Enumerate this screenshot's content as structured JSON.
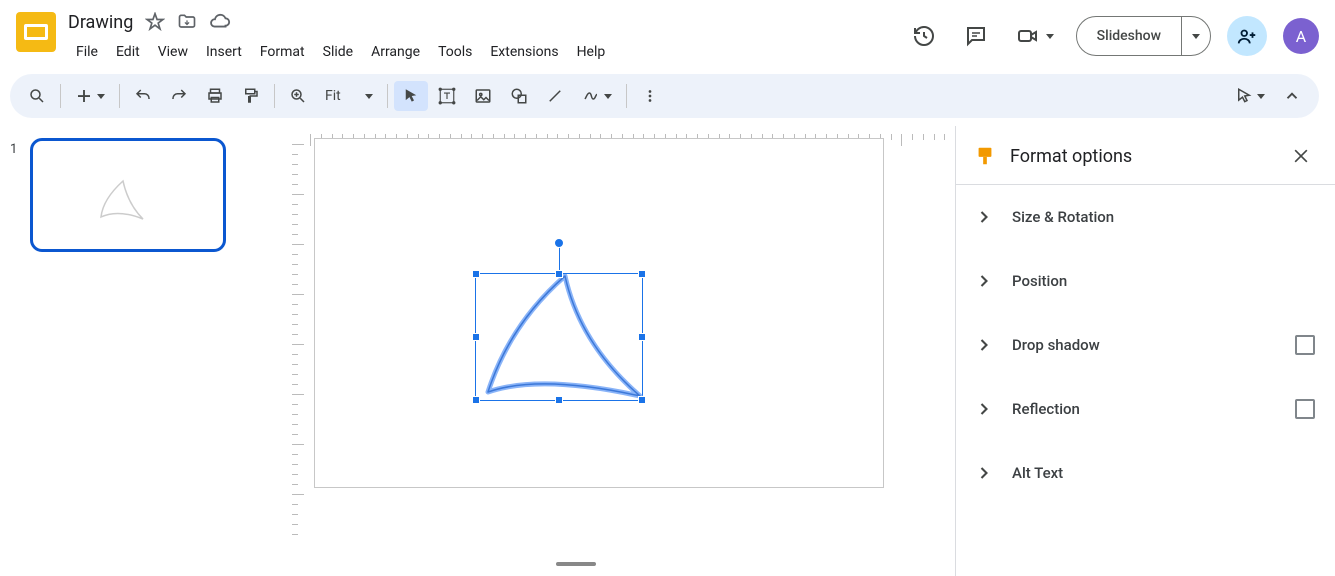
{
  "doc": {
    "title": "Drawing"
  },
  "menus": [
    "File",
    "Edit",
    "View",
    "Insert",
    "Format",
    "Slide",
    "Arrange",
    "Tools",
    "Extensions",
    "Help"
  ],
  "header": {
    "slideshow": "Slideshow",
    "avatar_initial": "A"
  },
  "toolbar": {
    "zoom": "Fit"
  },
  "thumbs": [
    {
      "number": "1"
    }
  ],
  "side_panel": {
    "title": "Format options",
    "sections": [
      {
        "label": "Size & Rotation",
        "has_checkbox": false
      },
      {
        "label": "Position",
        "has_checkbox": false
      },
      {
        "label": "Drop shadow",
        "has_checkbox": true
      },
      {
        "label": "Reflection",
        "has_checkbox": true
      },
      {
        "label": "Alt Text",
        "has_checkbox": false
      }
    ]
  }
}
